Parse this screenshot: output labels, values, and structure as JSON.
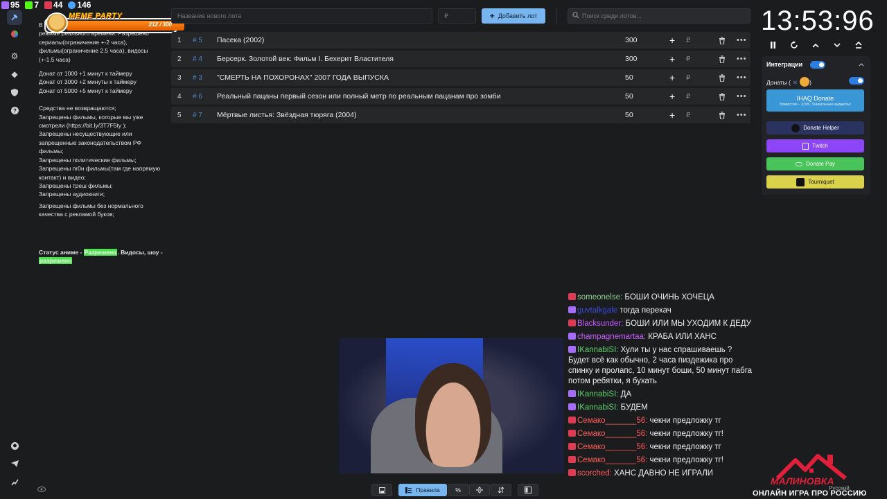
{
  "stats": [
    {
      "value": "95",
      "icon": "twitch-icon",
      "color": "#a66cff"
    },
    {
      "value": "7",
      "icon": "kick-icon",
      "color": "#53fc18"
    },
    {
      "value": "44",
      "icon": "live-icon",
      "color": "#e03b55"
    },
    {
      "value": "146",
      "icon": "viewers-icon",
      "color": "#4aa3ff"
    }
  ],
  "meme_party": {
    "title": "MEME PARTY",
    "count": "212 / 300"
  },
  "rules": {
    "intro": "В         через скрутку. Закидываю ваши донаты в режиме реального времени. Разрешено сериалы(ограничение +-2 часа), фильмы(ограничение 2.5 часа), видосы (+-1.5 часа)",
    "donate_lines": [
      "Донат от 1000 +1 минут к таймеру",
      "Донат от 3000 +2 минуты к таймеру",
      "Донат от 5000 +5 минут к таймеру"
    ],
    "restrictions": [
      "Средства не возвращаются;",
      "Запрещены фильмы, которые мы уже смотрели (https://bit.ly/3T7F5ty );",
      "Запрещены несуществующие или запрещенные законодательством РФ фильмы;",
      "Запрещены политические фильмы;",
      "Запрещены пr0н фильмы(там где напрямую контакт) и видео;",
      "Запрещены треш фильмы;",
      "Запрещены аудиокниги;",
      "Запрещены фильмы без нормального качества с рекламой буков;"
    ],
    "status_prefix": "Статус аниме - ",
    "status_anime": "Разрешено",
    "status_mid": ". Видосы, шоу - ",
    "status_shows": "разрешено"
  },
  "toolbar": {
    "lot_name_placeholder": "Название нового лота",
    "price_placeholder": "₽",
    "add_lot_label": "Добавить лот",
    "search_placeholder": "Поиск среди лотов..."
  },
  "lots": [
    {
      "num": "1",
      "id": "# 5",
      "title": "Пасека (2002)",
      "amount": "300"
    },
    {
      "num": "2",
      "id": "# 4",
      "title": "Берсерк. Золотой век: Фильм I. Бехерит Властителя",
      "amount": "300"
    },
    {
      "num": "3",
      "id": "# 3",
      "title": " \"СМЕРТЬ НА ПОХОРОНАХ\" 2007 ГОДА ВЫПУСКА",
      "amount": "50"
    },
    {
      "num": "4",
      "id": "# 6",
      "title": "Реальный пацаны первый сезон или полный метр по реальным пацанам про зомби",
      "amount": "50"
    },
    {
      "num": "5",
      "id": "# 7",
      "title": "Мёртвые листья: Звёздная тюряга (2004)",
      "amount": "50"
    }
  ],
  "lot_currency": "₽",
  "timer": {
    "value": "13:53:96"
  },
  "integrations": {
    "title": "Интеграции",
    "donates_label": "Донаты (",
    "donates_close": ")",
    "ihaq_label": "IHAQ Donate",
    "ihaq_sub": "Комиссия – 3,5%. Уникальные виджеты!",
    "buttons": [
      {
        "label": "Donate Helper",
        "color": "#2a3260"
      },
      {
        "label": "Twitch",
        "color": "#8c45f7"
      },
      {
        "label": "Donate Pay",
        "color": "#49c35a"
      },
      {
        "label": "Tourniquet",
        "color": "#d9d24a"
      }
    ]
  },
  "chat": [
    {
      "badge": "live",
      "nick": "someonelse:",
      "nick_color": "#8fd18f",
      "text": " БОШИ ОЧИНЬ ХОЧЕЦА"
    },
    {
      "badge": "twitch",
      "nick": "guvtalkgale",
      "nick_color": "#3b4bd8",
      "text": " тогда перекач"
    },
    {
      "badge": "live",
      "nick": "Blacksunder:",
      "nick_color": "#c85cff",
      "text": " БОШИ ИЛИ МЫ УХОДИМ К ДЕДУ"
    },
    {
      "badge": "twitch",
      "nick": "champagnemartaa:",
      "nick_color": "#c85cff",
      "text": " КРАБА ИЛИ ХАНС"
    },
    {
      "badge": "twitch",
      "nick": "IKannabiSI:",
      "nick_color": "#5fd06f",
      "text": " Хули ты у нас спрашиваешь ? Будет всё как обычно, 2 часа пиздежика про спинку и пролапс, 10 минут боши, 50 минут пабга потом       ребятки, я бухать"
    },
    {
      "badge": "twitch",
      "nick": "IKannabiSI:",
      "nick_color": "#5fd06f",
      "text": " ДА"
    },
    {
      "badge": "twitch",
      "nick": "IKannabiSI:",
      "nick_color": "#5fd06f",
      "text": " БУДЕМ"
    },
    {
      "badge": "live",
      "nick": "Семако_______56:",
      "nick_color": "#ff5b5b",
      "text": " чекни предложку тг"
    },
    {
      "badge": "live",
      "nick": "Семако_______56:",
      "nick_color": "#ff5b5b",
      "text": " чекни предложку тг!"
    },
    {
      "badge": "live",
      "nick": "Семако_______56:",
      "nick_color": "#ff5b5b",
      "text": " чекни предложку тг"
    },
    {
      "badge": "live",
      "nick": "Семако_______56:",
      "nick_color": "#ff5b5b",
      "text": " чекни предложку тг!"
    },
    {
      "badge": "live",
      "nick": "scorched:",
      "nick_color": "#ff5b5b",
      "text": " ХАНС ДАВНО НЕ ИГРАЛИ"
    }
  ],
  "bottom_toolbar": {
    "rules_label": "Правила"
  },
  "branding": {
    "logo_word": "МАЛИНОВКА",
    "slogan": "ОНЛАЙН ИГРА ПРО РОССИЮ",
    "language": "Русский"
  }
}
